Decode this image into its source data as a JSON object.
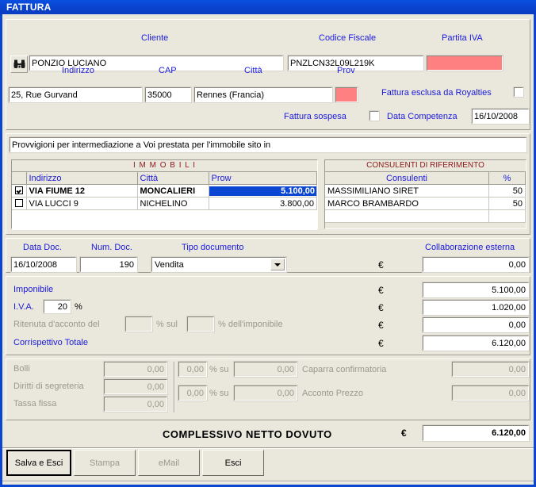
{
  "window": {
    "title": "FATTURA"
  },
  "header": {
    "search_icon": "binoculars-icon",
    "cliente_label": "Cliente",
    "cliente_value": "PONZIO LUCIANO",
    "codice_fiscale_label": "Codice Fiscale",
    "codice_fiscale_value": "PNZLCN32L09L219K",
    "partita_iva_label": "Partita IVA",
    "partita_iva_value": "",
    "indirizzo_label": "Indirizzo",
    "indirizzo_value": "25, Rue Gurvand",
    "cap_label": "CAP",
    "cap_value": "35000",
    "citta_label": "Città",
    "citta_value": "Rennes (Francia)",
    "prov_label": "Prov",
    "prov_value": "",
    "royalties_label": "Fattura esclusa da Royalties",
    "royalties_checked": false,
    "sospesa_label": "Fattura sospesa",
    "sospesa_checked": false,
    "data_competenza_label": "Data Competenza",
    "data_competenza_value": "16/10/2008"
  },
  "description": {
    "value": "Provvigioni per intermediazione a Voi prestata per l'immobile sito in"
  },
  "immobili": {
    "title": "I M M O B I L I",
    "columns": [
      "",
      "Indirizzo",
      "Città",
      "Prow"
    ],
    "rows": [
      {
        "checked": true,
        "indirizzo": "VIA FIUME 12",
        "citta": "MONCALIERI",
        "provv": "5.100,00",
        "selected": true
      },
      {
        "checked": false,
        "indirizzo": "VIA LUCCI 9",
        "citta": "NICHELINO",
        "provv": "3.800,00",
        "selected": false
      }
    ]
  },
  "consulenti": {
    "title": "CONSULENTI DI RIFERIMENTO",
    "columns": [
      "Consulenti",
      "%"
    ],
    "rows": [
      {
        "nome": "MASSIMILIANO SIRET",
        "perc": "50"
      },
      {
        "nome": "MARCO BRAMBARDO",
        "perc": "50"
      },
      {
        "nome": "",
        "perc": ""
      }
    ]
  },
  "document": {
    "data_doc_label": "Data Doc.",
    "data_doc_value": "16/10/2008",
    "num_doc_label": "Num. Doc.",
    "num_doc_value": "190",
    "tipo_doc_label": "Tipo documento",
    "tipo_doc_value": "Vendita",
    "collaborazione_label": "Collaborazione esterna",
    "collaborazione_value": "0,00",
    "currency": "€"
  },
  "totals": {
    "imponibile_label": "Imponibile",
    "imponibile_value": "5.100,00",
    "iva_label": "I.V.A.",
    "iva_rate": "20",
    "iva_percent_sign": "%",
    "iva_value": "1.020,00",
    "ritenuta_label_1": "Ritenuta d'acconto del",
    "ritenuta_rate_1": "",
    "ritenuta_label_2": "% sul",
    "ritenuta_rate_2": "",
    "ritenuta_label_3": "% dell'imponibile",
    "ritenuta_value": "0,00",
    "corrispettivo_label": "Corrispettivo Totale",
    "corrispettivo_value": "6.120,00",
    "currency": "€"
  },
  "fees": {
    "bolli_label": "Bolli",
    "bolli_value": "0,00",
    "diritti_label": "Diritti di segreteria",
    "diritti_value": "0,00",
    "tassa_label": "Tassa fissa",
    "tassa_value": "0,00",
    "caparra_pct": "0,00",
    "caparra_su_label": "% su",
    "caparra_base": "0,00",
    "caparra_label": "Caparra confirmatoria",
    "caparra_value": "0,00",
    "acconto_pct": "0,00",
    "acconto_su_label": "% su",
    "acconto_base": "0,00",
    "acconto_label": "Acconto Prezzo",
    "acconto_value": "0,00"
  },
  "grand_total": {
    "label": "COMPLESSIVO NETTO DOVUTO",
    "currency": "€",
    "value": "6.120,00"
  },
  "buttons": {
    "save_exit": "Salva e Esci",
    "print": "Stampa",
    "email": "eMail",
    "exit": "Esci"
  },
  "colors": {
    "titlebar": "#0a46d2",
    "face": "#eae8dc",
    "label": "#1a1adc",
    "required": "#ff8080",
    "grid_title": "#8b1a1a",
    "selection": "#0a46d2"
  }
}
